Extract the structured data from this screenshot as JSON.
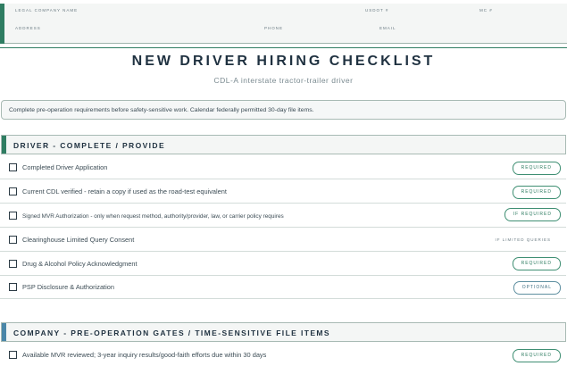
{
  "header": {
    "legal_company_name": "LEGAL COMPANY NAME",
    "usdot": "USDOT #",
    "mc": "MC #",
    "address": "ADDRESS",
    "phone": "PHONE",
    "email": "EMAIL"
  },
  "title": "NEW DRIVER HIRING CHECKLIST",
  "subtitle": "CDL-A interstate tractor-trailer driver",
  "note": "Complete pre-operation requirements before safety-sensitive work. Calendar federally permitted 30-day file items.",
  "sections": [
    {
      "title": "DRIVER - COMPLETE / PROVIDE",
      "items": [
        {
          "text": "Completed Driver Application",
          "status": "REQUIRED"
        },
        {
          "text": "Current CDL verified - retain a copy if used as the road-test equivalent",
          "status": "REQUIRED"
        },
        {
          "text": "Signed MVR Authorization - only when request method, authority/provider, law, or carrier policy requires",
          "status": "IF REQUIRED"
        },
        {
          "text": "Clearinghouse Limited Query Consent",
          "status": "IF LIMITED QUERIES"
        },
        {
          "text": "Drug & Alcohol Policy Acknowledgment",
          "status": "REQUIRED"
        },
        {
          "text": "PSP Disclosure & Authorization",
          "status": "OPTIONAL"
        }
      ]
    },
    {
      "title": "COMPANY - PRE-OPERATION GATES / TIME-SENSITIVE FILE ITEMS",
      "items": [
        {
          "text": "Available MVR reviewed; 3-year inquiry results/good-faith efforts due within 30 days",
          "status": "REQUIRED"
        }
      ]
    }
  ],
  "colors": {
    "accent_green": "#2f7d62",
    "accent_blue": "#4a86a8",
    "border": "#a8bab4"
  }
}
